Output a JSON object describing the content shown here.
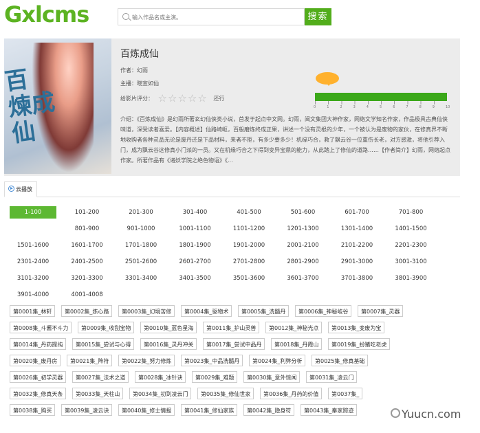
{
  "header": {
    "logo_text": "Gxlcms",
    "search_placeholder": "输入作品名或主演。",
    "search_button": "搜索"
  },
  "book": {
    "title": "百炼成仙",
    "author_label": "作者：幻雨",
    "cast_label": "主播：晓宣如仙",
    "rating_label": "给影片评分：",
    "rating_value": 0,
    "rating_max": 5,
    "rating_action": "还行",
    "score_value": 0,
    "score_scale": [
      "0",
      "1",
      "2",
      "3",
      "4",
      "5",
      "6",
      "7",
      "8",
      "9",
      "10"
    ],
    "cover_title": "百炼成仙",
    "intro": "介绍：《百炼成仙》是幻雨所著玄幻仙侠类小说，首发于起点中文网。幻雨，阅文集团大神作家，网络文学知名作家，作品极具古典仙侠味道，深受读者喜爱。【内容概述】仙路崎岖，百般磨炼终成正果，讲述一个没有灵根的少年，一个被认为是废物的家伙，在修真界不断地收购者各种灵品无论是废丹还是下品材料，来者不拒，有多少要多少！机缘巧合，救了飘云谷一位重伤长老，对方感激，将他引荐入门，成为飘云谷这修真小门派的一员。又在机缘巧合之下得到变异宝鼎的能力，从此踏上了修仙的道路……【作者简介】幻雨，网络起点作家。所著作品有《诸妖学院之绝色物语》《..."
  },
  "tabs": [
    {
      "label": "云播放"
    }
  ],
  "ranges": [
    "1-100",
    "101-200",
    "201-300",
    "301-400",
    "401-500",
    "501-600",
    "601-700",
    "701-800",
    "801-900",
    "901-1000",
    "1001-1100",
    "1101-1200",
    "1201-1300",
    "1301-1400",
    "1401-1500",
    "1501-1600",
    "1601-1700",
    "1701-1800",
    "1801-1900",
    "1901-2000",
    "2001-2100",
    "2101-2200",
    "2201-2300",
    "2301-2400",
    "2401-2500",
    "2501-2600",
    "2601-2700",
    "2701-2800",
    "2801-2900",
    "2901-3000",
    "3001-3100",
    "3101-3200",
    "3201-3300",
    "3301-3400",
    "3401-3500",
    "3501-3600",
    "3601-3700",
    "3701-3800",
    "3801-3900",
    "3901-4000",
    "4001-4008"
  ],
  "episodes": [
    [
      "第0001集_林轩",
      "第0002集_炼心路",
      "第0003集_幻境苦修",
      "第0004集_驱物术",
      "第0005集_洗髓丹",
      "第0006集_神秘岐谷",
      "第0007集_灵器"
    ],
    [
      "第0008集_斗酱不斗力",
      "第0009集_收刮宝物",
      "第0010集_蓝色星海",
      "第0011集_护山灵兽",
      "第0012集_神秘光点",
      "第0013集_变废为宝"
    ],
    [
      "第0014集_丹药提纯",
      "第0015集_尝试与心得",
      "第0016集_灵丹冲关",
      "第0017集_尝试中品丹",
      "第0018集_丹霞山",
      "第0019集_扮猪吃老虎"
    ],
    [
      "第0020集_废丹房",
      "第0021集_阵符",
      "第0022集_努力修炼",
      "第0023集_中品洗髓丹",
      "第0024集_利弊分析",
      "第0025集_修真基础"
    ],
    [
      "第0026集_初学灵器",
      "第0027集_法术之道",
      "第0028集_冰针诀",
      "第0029集_难题",
      "第0030集_意外惊闻",
      "第0031集_凌云门"
    ],
    [
      "第0032集_修真天条",
      "第0033集_天柱山",
      "第0034集_初到凌云门",
      "第0035集_修仙世家",
      "第0036集_丹药的价值",
      "第0037集_"
    ],
    [
      "第0038集_购买",
      "第0039集_凌云诀",
      "第0040集_修士情报",
      "第0041集_修仙家族",
      "第0042集_隐身符",
      "第0043集_秦家踪迹"
    ]
  ],
  "watermark": "Yuucn.com"
}
